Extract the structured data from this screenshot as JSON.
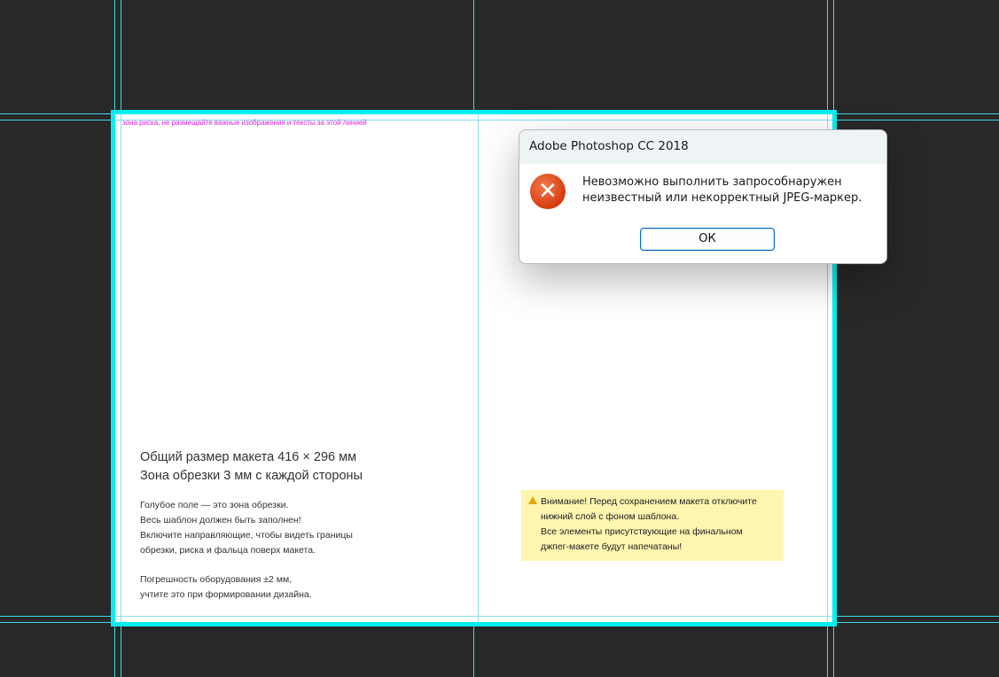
{
  "document": {
    "risk_note": "зона риска, не размещайте важные изображения и тексты за этой линией",
    "info": {
      "title_line1": "Общий размер макета 416 × 296 мм",
      "title_line2": "Зона обрезки 3 мм с каждой стороны",
      "para1_line1": "Голубое поле — это зона обрезки.",
      "para1_line2": "Весь шаблон должен быть заполнен!",
      "para1_line3": "Включите направляющие, чтобы видеть границы",
      "para1_line4": "обрезки, риска и фальца поверх макета.",
      "para2_line1": "Погрешность оборудования ±2 мм,",
      "para2_line2": "учтите это при формировании дизайна."
    },
    "warning": {
      "line1": "Внимание! Перед сохранением макета отключите",
      "line2": "нижний слой с фоном шаблона.",
      "line3": "Все элементы присутствующие на финальном",
      "line4": "джпег-макете будут напечатаны!",
      "icon": "warning-icon"
    }
  },
  "dialog": {
    "title": "Adobe Photoshop CC 2018",
    "message_line1": "Невозможно выполнить запрособнаружен",
    "message_line2": "неизвестный или некорректный JPEG-маркер.",
    "ok_label": "ОК",
    "icon": "error-icon"
  },
  "colors": {
    "background": "#282828",
    "guide": "#3fd9e6",
    "bleed_border": "#00f0f0",
    "risk_note": "#e020e0",
    "warning_bg": "#fdf5b0",
    "error_icon": "#d73a10",
    "button_border": "#0067c0"
  }
}
